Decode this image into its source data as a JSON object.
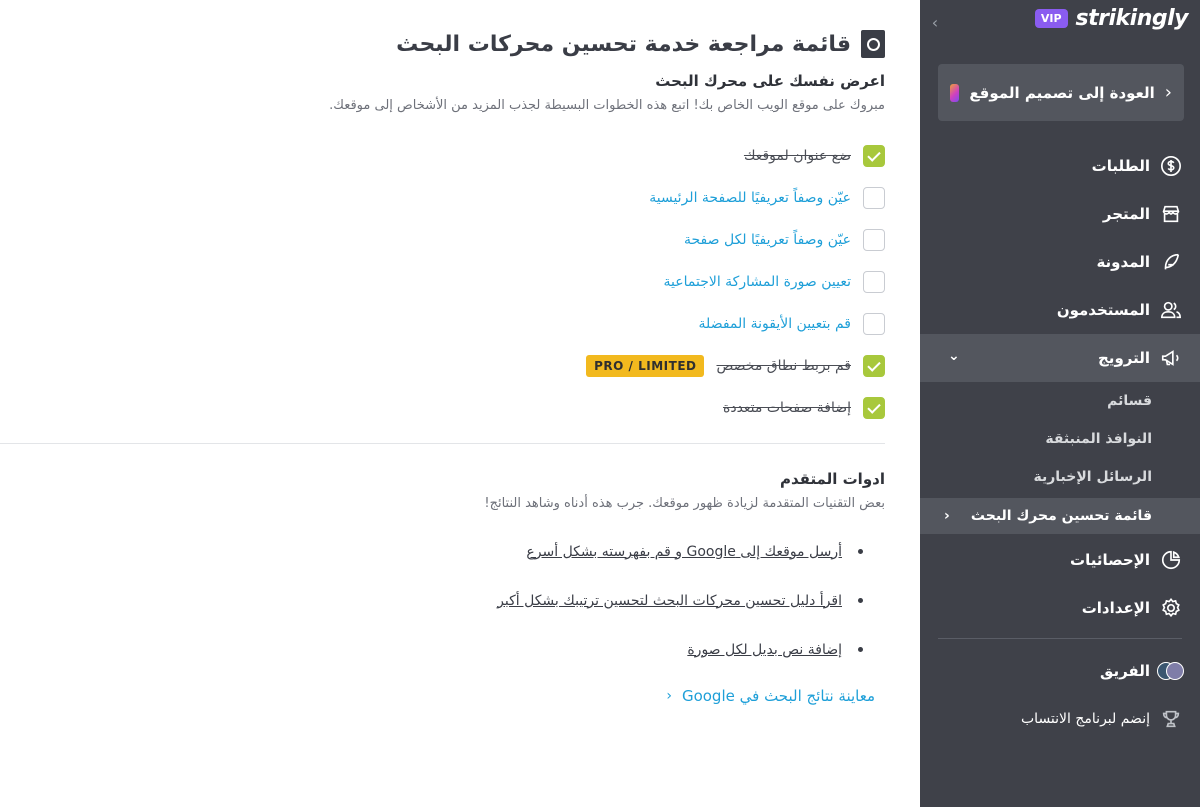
{
  "brand": {
    "logo": "strikingly",
    "badge": "VIP"
  },
  "sidebar": {
    "collapse_icon": "chevron-right-icon",
    "back_button": {
      "label": "العودة إلى تصميم الموقع"
    },
    "items": [
      {
        "label": "الطلبات",
        "icon": "dollar-circle-icon"
      },
      {
        "label": "المتجر",
        "icon": "store-icon"
      },
      {
        "label": "المدونة",
        "icon": "feather-icon"
      },
      {
        "label": "المستخدمون",
        "icon": "users-icon"
      },
      {
        "label": "الترويج",
        "icon": "megaphone-icon"
      }
    ],
    "promo_sub": [
      {
        "label": "قسائم"
      },
      {
        "label": "النوافذ المنبثقة"
      },
      {
        "label": "الرسائل الإخبارية"
      },
      {
        "label": "قائمة تحسين محرك البحث"
      }
    ],
    "items_after": [
      {
        "label": "الإحصائيات",
        "icon": "pie-chart-icon"
      },
      {
        "label": "الإعدادات",
        "icon": "gear-icon"
      }
    ],
    "team": {
      "label": "الفريق"
    },
    "affiliate": {
      "label": "إنضم لبرنامج الانتساب"
    }
  },
  "main": {
    "title": "قائمة مراجعة خدمة تحسين محركات البحث",
    "section1": {
      "heading": "اعرض نفسك على محرك البحث",
      "desc": "مبروك على موقع الويب الخاص بك! اتبع هذه الخطوات البسيطة لجذب المزيد من الأشخاص إلى موقعك."
    },
    "checklist": [
      {
        "label": "ضع عنوان لموقعك",
        "checked": true
      },
      {
        "label": "عيّن وصفاً تعريفيًا للصفحة الرئيسية",
        "checked": false
      },
      {
        "label": "عيّن وصفاً تعريفيًا لكل صفحة",
        "checked": false
      },
      {
        "label": "تعيين صورة المشاركة الاجتماعية",
        "checked": false
      },
      {
        "label": "قم بتعيين الأيقونة المفضلة",
        "checked": false
      },
      {
        "label": "قم بربط نطاق مخصص",
        "checked": true,
        "badge": "PRO / LIMITED"
      },
      {
        "label": "إضافة صفحات متعددة",
        "checked": true
      }
    ],
    "advanced": {
      "heading": "ادوات المتقدم",
      "desc": "بعض التقنيات المتقدمة لزيادة ظهور موقعك. جرب هذه أدناه وشاهد النتائج!",
      "tools": [
        "أرسل موقعك إلى Google و قم بفهرسته بشكل أسرع",
        "اقرأ دليل تحسين محركات البحث لتحسين ترتيبك بشكل أكبر",
        "إضافة نص بديل لكل صورة"
      ],
      "preview_link": "معاينة نتائج البحث في Google"
    }
  },
  "colors": {
    "sidebar_bg": "#3f4149",
    "sidebar_active": "#53565e",
    "check_green": "#a8c83c",
    "link_blue": "#1e9fd8",
    "pro_yellow": "#f2b91e",
    "vip_purple": "#8a5cf0"
  }
}
